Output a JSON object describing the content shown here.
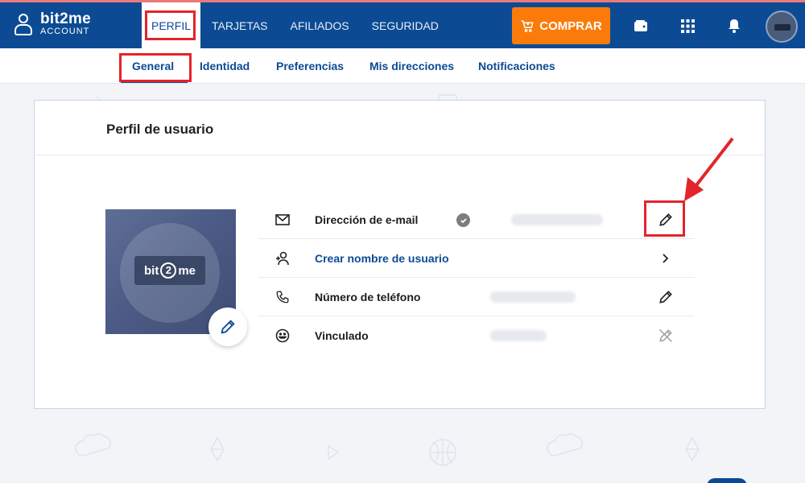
{
  "brand": {
    "name": "bit2me",
    "sub": "ACCOUNT"
  },
  "main_nav": {
    "items": [
      {
        "label": "PERFIL",
        "active": true
      },
      {
        "label": "TARJETAS"
      },
      {
        "label": "AFILIADOS"
      },
      {
        "label": "SEGURIDAD"
      }
    ]
  },
  "buy_button": {
    "label": "COMPRAR"
  },
  "top_icons": [
    "wallet-icon",
    "apps-grid-icon",
    "bell-icon"
  ],
  "sub_nav": {
    "tabs": [
      {
        "label": "General",
        "active": true
      },
      {
        "label": "Identidad"
      },
      {
        "label": "Preferencias"
      },
      {
        "label": "Mis direcciones"
      },
      {
        "label": "Notificaciones"
      }
    ]
  },
  "profile": {
    "title": "Perfil de usuario",
    "photo_brand": {
      "left": "bit",
      "middle": "2",
      "right": "me"
    },
    "rows": [
      {
        "icon": "mail-icon",
        "label": "Dirección de e-mail",
        "verified": true,
        "action": "pencil-icon"
      },
      {
        "icon": "add-user-icon",
        "label": "Crear nombre de usuario",
        "link": true,
        "action": "chevron-right-icon"
      },
      {
        "icon": "phone-icon",
        "label": "Número de teléfono",
        "action": "pencil-icon"
      },
      {
        "icon": "smile-icon",
        "label": "Vinculado",
        "action": "pencil-disabled-icon"
      }
    ]
  },
  "colors": {
    "primary": "#0c4b94",
    "accent": "#fb7b0a",
    "highlight": "#e3242b"
  }
}
